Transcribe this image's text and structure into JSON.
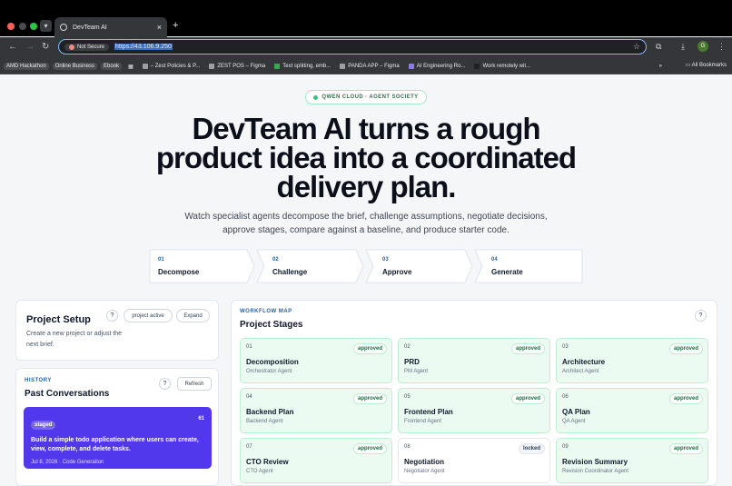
{
  "browser": {
    "tab_title": "DevTeam AI",
    "tab_close": "×",
    "new_tab": "+",
    "not_secure": "Not Secure",
    "url": "https://43.106.9.250",
    "profile_initial": "G",
    "bookmarks": [
      "AMD Hackathon",
      "Online Business",
      "Ebook",
      "– Zest Policies & P...",
      "ZEST POS – Figma",
      "Text splitting, emb...",
      "PANDA APP – Figma",
      "AI Engineering Ro...",
      "Work remotely wit..."
    ],
    "more_bookmarks": "»",
    "all_bookmarks": "All Bookmarks"
  },
  "hero": {
    "badge": "QWEN CLOUD · AGENT SOCIETY",
    "title": "DevTeam AI turns a rough product idea into a coordinated delivery plan.",
    "subtitle": "Watch specialist agents decompose the brief, challenge assumptions, negotiate decisions, approve stages, compare against a baseline, and produce starter code."
  },
  "steps": [
    {
      "num": "01",
      "label": "Decompose"
    },
    {
      "num": "02",
      "label": "Challenge"
    },
    {
      "num": "03",
      "label": "Approve"
    },
    {
      "num": "04",
      "label": "Generate"
    }
  ],
  "setup": {
    "title": "Project Setup",
    "help": "?",
    "status": "project active",
    "expand": "Expand",
    "desc": "Create a new project or adjust the next brief."
  },
  "history": {
    "eyebrow": "HISTORY",
    "title": "Past Conversations",
    "help": "?",
    "refresh": "Refresh",
    "items": [
      {
        "status": "staged",
        "count": "61",
        "text": "Build a simple todo application where users can create, view, complete, and delete tasks.",
        "meta": "Jul 8, 2026 · Code Generation"
      }
    ]
  },
  "workflow": {
    "eyebrow": "WORKFLOW MAP",
    "title": "Project Stages",
    "help": "?",
    "stages": [
      {
        "num": "01",
        "name": "Decomposition",
        "agent": "Orchestrator Agent",
        "status": "approved"
      },
      {
        "num": "02",
        "name": "PRD",
        "agent": "PM Agent",
        "status": "approved"
      },
      {
        "num": "03",
        "name": "Architecture",
        "agent": "Architect Agent",
        "status": "approved"
      },
      {
        "num": "04",
        "name": "Backend Plan",
        "agent": "Backend Agent",
        "status": "approved"
      },
      {
        "num": "05",
        "name": "Frontend Plan",
        "agent": "Frontend Agent",
        "status": "approved"
      },
      {
        "num": "06",
        "name": "QA Plan",
        "agent": "QA Agent",
        "status": "approved"
      },
      {
        "num": "07",
        "name": "CTO Review",
        "agent": "CTO Agent",
        "status": "approved"
      },
      {
        "num": "08",
        "name": "Negotiation",
        "agent": "Negotiator Agent",
        "status": "locked"
      },
      {
        "num": "09",
        "name": "Revision Summary",
        "agent": "Revision Coordinator Agent",
        "status": "approved"
      }
    ]
  }
}
